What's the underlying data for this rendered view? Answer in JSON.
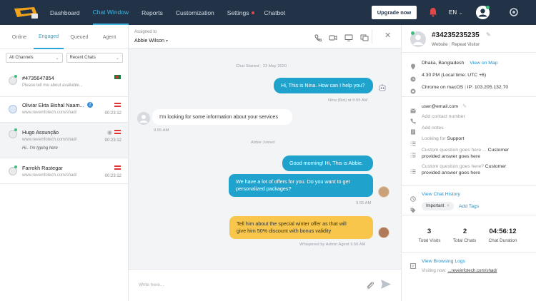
{
  "nav": {
    "items": [
      "Dashboard",
      "Chat Window",
      "Reports",
      "Customization",
      "Settings",
      "Chatbot"
    ],
    "upgrade": "Upgrade now",
    "lang": "EN"
  },
  "left": {
    "tabs": [
      "Online",
      "Engaged",
      "Queued",
      "Agent"
    ],
    "filter_channels": "All Channels",
    "filter_chats": "Recent Chats",
    "chats": [
      {
        "name": "#4735647854",
        "sub": "Please tell me about available...",
        "time": ""
      },
      {
        "name": "Oliviar Ekta Bishal Naam...",
        "sub": "www.reveinfotech.com/shad/",
        "time": "00:23:12"
      },
      {
        "name": "Hugo Assunção",
        "sub": "www.reveinfotech.com/shad/",
        "typing": "Hi.. I'm typing here",
        "time": "00:23:12"
      },
      {
        "name": "Farrokh Rastegar",
        "sub": "www.reveinfotech.com/shad/",
        "time": "00:23:12"
      }
    ]
  },
  "mid": {
    "assigned_label": "Assigned to",
    "assigned_name": "Abbie Wilson",
    "started": "Chat Started - 23 May 2020",
    "m1": "Hi, This is Nina. How can I help you?",
    "m1_meta": "Nina (Bot) at 9.55 AM",
    "m2": "I'm looking for some information about your services",
    "m2_meta": "9.55 AM",
    "joined": "Abbie Joined",
    "m3": "Good morning! Hi, This is Abbie.",
    "m4a": "We have a lot of offers for you. Do you want to get",
    "m4b": "personalized packages?",
    "m4_meta": "9.55 AM",
    "m5a": "Tell him about the special winter offer as that will",
    "m5b": "give him 50% discount with bonus validity",
    "m5_meta": "Whispered by Admin Agent 9.56 AM",
    "placeholder": "Write here..."
  },
  "right": {
    "id": "#34235235235",
    "src": "Website",
    "type": "Repeat Visitor",
    "location": "Dhaka, Bangladesh",
    "map": "View on Map",
    "time": "4:30 PM (Local time: UTC +6)",
    "browser": "Chrome on macOS",
    "ip": "IP: 103.205.132.70",
    "email": "user@email.com",
    "add_contact": "Add contact number",
    "add_notes": "Add notes",
    "looking_label": "Looking for",
    "looking_value": "Support",
    "q1": "Custom question goes here ...",
    "a1": "Customer",
    "a1b": "provided answer goes here",
    "q2": "Custom question goes here?",
    "a2": "Customer",
    "a2b": "provided answer goes here",
    "history": "View Chat History",
    "tag": "Important",
    "add_tags": "Add Tags",
    "visits": "3",
    "visits_lbl": "Total Visits",
    "chats": "2",
    "chats_lbl": "Total Chats",
    "duration": "04:56:12",
    "duration_lbl": "Chat Duration",
    "browsing": "View Browsing Logs",
    "visiting_label": "Visiting now:",
    "visiting_url": "...reveinfotech.com/shad/"
  }
}
